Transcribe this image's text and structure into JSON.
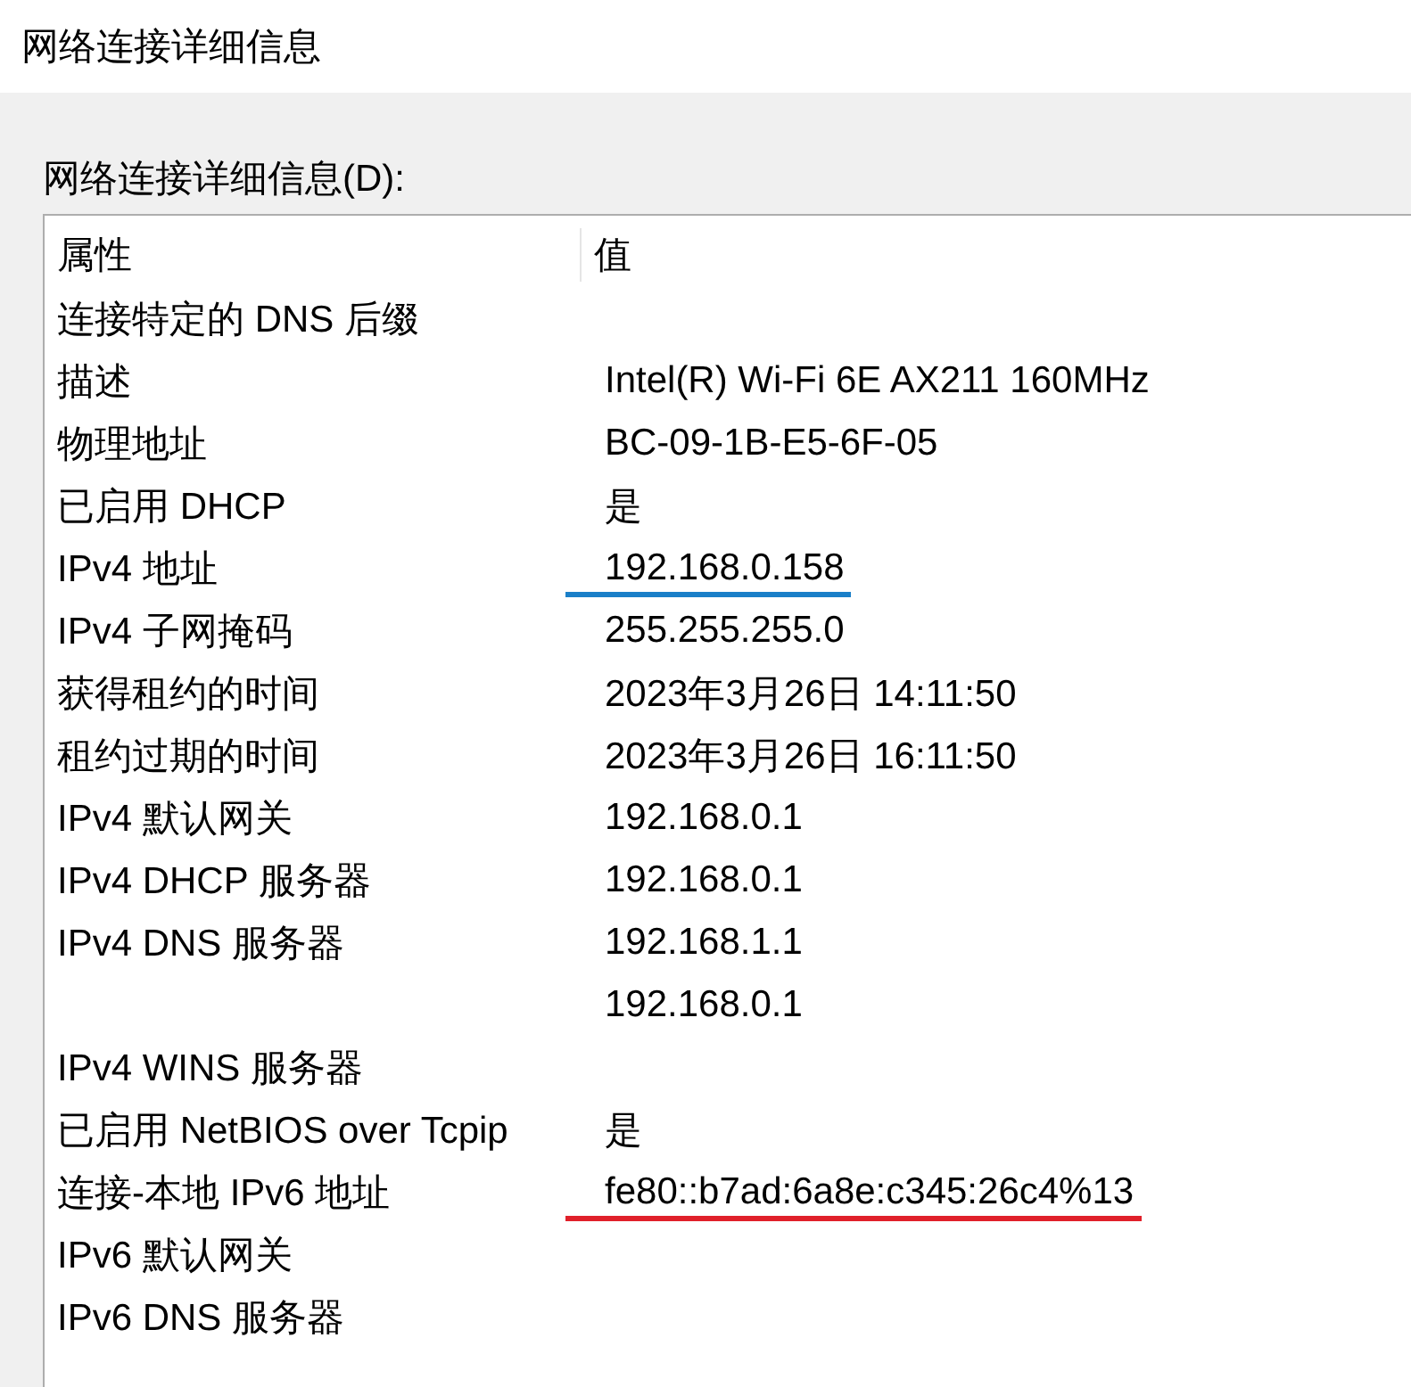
{
  "window": {
    "title": "网络连接详细信息"
  },
  "list_label": "网络连接详细信息(D):",
  "table": {
    "columns": [
      "属性",
      "值"
    ],
    "rows": [
      {
        "property": "连接特定的 DNS 后缀",
        "value": ""
      },
      {
        "property": "描述",
        "value": "Intel(R) Wi-Fi 6E AX211 160MHz"
      },
      {
        "property": "物理地址",
        "value": "BC-09-1B-E5-6F-05"
      },
      {
        "property": "已启用 DHCP",
        "value": "是"
      },
      {
        "property": "IPv4 地址",
        "value": "192.168.0.158",
        "color": "#1a7fc8"
      },
      {
        "property": "IPv4 子网掩码",
        "value": "255.255.255.0"
      },
      {
        "property": "获得租约的时间",
        "value": "2023年3月26日 14:11:50"
      },
      {
        "property": "租约过期的时间",
        "value": "2023年3月26日 16:11:50"
      },
      {
        "property": "IPv4 默认网关",
        "value": "192.168.0.1"
      },
      {
        "property": "IPv4 DHCP 服务器",
        "value": "192.168.0.1"
      },
      {
        "property": "IPv4 DNS 服务器",
        "value": "192.168.1.1"
      },
      {
        "property": "",
        "value": "192.168.0.1"
      },
      {
        "property": "IPv4 WINS 服务器",
        "value": ""
      },
      {
        "property": "已启用 NetBIOS over Tcpip",
        "value": "是"
      },
      {
        "property": "连接-本地 IPv6 地址",
        "value": "fe80::b7ad:6a8e:c345:26c4%13",
        "color": "#e0202a"
      },
      {
        "property": "IPv6 默认网关",
        "value": ""
      },
      {
        "property": "IPv6 DNS 服务器",
        "value": ""
      }
    ]
  }
}
